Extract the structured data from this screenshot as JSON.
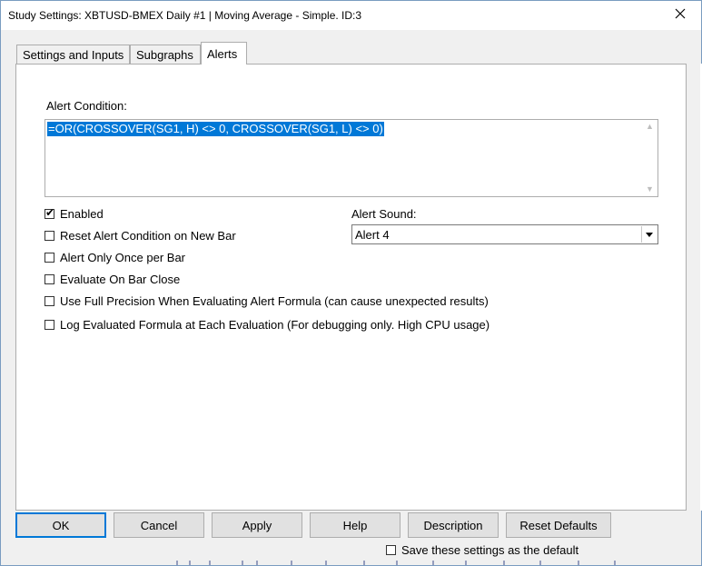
{
  "window": {
    "title": "Study Settings: XBTUSD-BMEX  Daily  #1 | Moving Average - Simple. ID:3",
    "close_glyph": "✕"
  },
  "tabs": [
    {
      "label": "Settings and Inputs",
      "active": false
    },
    {
      "label": "Subgraphs",
      "active": false
    },
    {
      "label": "Alerts",
      "active": true
    }
  ],
  "alerts": {
    "condition_label": "Alert Condition:",
    "condition_value": "=OR(CROSSOVER(SG1, H) <> 0, CROSSOVER(SG1, L) <> 0)",
    "sound_label": "Alert Sound:",
    "sound_value": "Alert 4",
    "checkboxes": [
      {
        "label": "Enabled",
        "checked": true
      },
      {
        "label": "Reset Alert Condition on New Bar",
        "checked": false
      },
      {
        "label": "Alert Only Once per Bar",
        "checked": false
      },
      {
        "label": "Evaluate On Bar Close",
        "checked": false
      },
      {
        "label": "Use Full Precision When Evaluating Alert Formula (can cause unexpected results)",
        "checked": false
      },
      {
        "label": "Log Evaluated Formula at Each Evaluation (For debugging only. High CPU usage)",
        "checked": false
      }
    ]
  },
  "buttons": {
    "ok": "OK",
    "cancel": "Cancel",
    "apply": "Apply",
    "help": "Help",
    "description": "Description",
    "reset_defaults": "Reset Defaults"
  },
  "footer": {
    "save_default_label": "Save these settings as the default",
    "save_default_checked": false
  },
  "icons": {
    "close": "close-icon",
    "checkmark": "checkmark-icon",
    "dropdown_arrow": "chevron-down-icon",
    "scroll_up": "scroll-up-icon",
    "scroll_down": "scroll-down-icon"
  },
  "colors": {
    "selection": "#0078d7",
    "default_button_border": "#0078d7",
    "dialog_bg": "#f0f0f0",
    "panel_bg": "#ffffff"
  }
}
